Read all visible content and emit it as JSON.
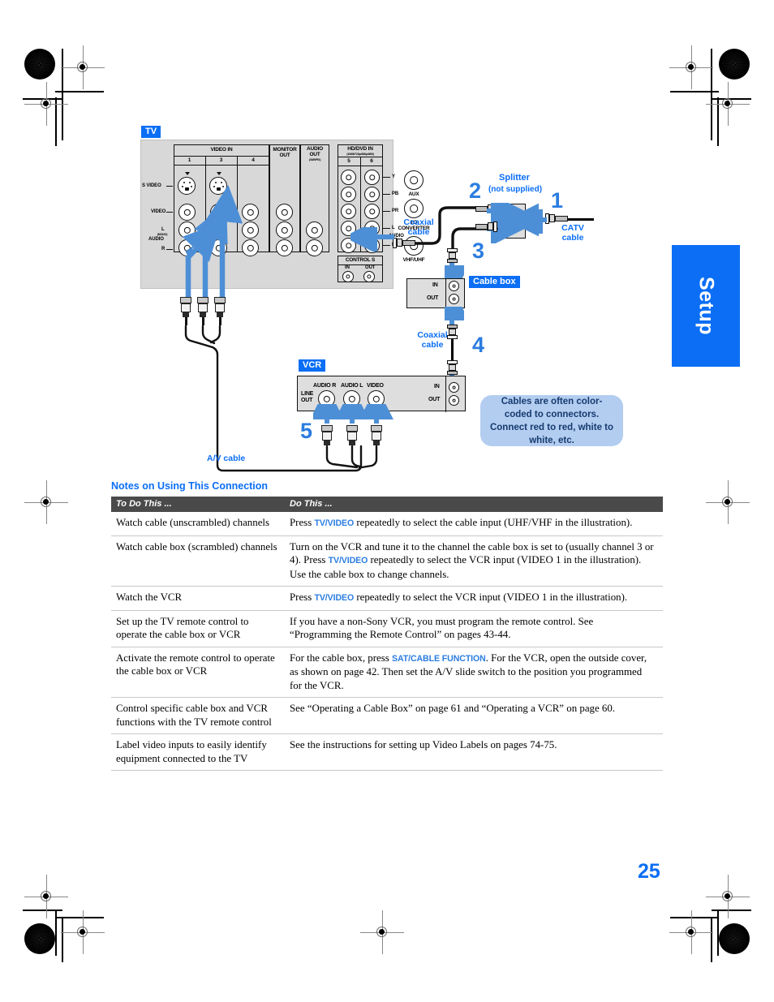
{
  "page": {
    "number": "25",
    "tab_label": "Setup"
  },
  "diagram": {
    "tv_badge": "TV",
    "vcr_badge": "VCR",
    "cable_box_badge": "Cable box",
    "tv_panel": {
      "video_in_title": "VIDEO IN",
      "video_in_columns": [
        "1",
        "3",
        "4"
      ],
      "monitor_out_title": "MONITOR\nOUT",
      "audio_out_title": "AUDIO\nOUT",
      "audio_out_sub": "(VAR/FIX)",
      "row_labels": [
        "S VIDEO",
        "VIDEO",
        "L",
        "AUDIO",
        "R"
      ],
      "l_sub": "(MONO)",
      "hd_dvd_title": "HD/DVD IN",
      "hd_dvd_sub": "(1080i/720p/480p/480i)",
      "hd_dvd_columns": [
        "5",
        "6"
      ],
      "hd_dvd_rows": [
        "Y",
        "PB",
        "PR",
        "L",
        "R"
      ],
      "hd_dvd_audio_label": "AUDIO",
      "aux_label": "AUX",
      "to_converter_label": "TO\nCONVERTER",
      "vhf_uhf_label": "VHF/UHF",
      "control_s_title": "CONTROL S",
      "control_s_in": "IN",
      "control_s_out": "OUT"
    },
    "vcr_panel": {
      "line_out_label": "LINE\nOUT",
      "jack_labels": [
        "AUDIO R",
        "AUDIO L",
        "VIDEO"
      ],
      "in_label": "IN",
      "out_label": "OUT"
    },
    "cable_box": {
      "in_label": "IN",
      "out_label": "OUT"
    },
    "steps": [
      "1",
      "2",
      "3",
      "4",
      "5"
    ],
    "labels": {
      "splitter": "Splitter",
      "splitter_sub": "(not supplied)",
      "catv_cable": "CATV\ncable",
      "coaxial_cable": "Coaxial\ncable",
      "av_cable": "A/V cable"
    },
    "bubble": "Cables are often color-coded to connectors. Connect red to red, white to white, etc."
  },
  "notes": {
    "heading": "Notes on Using This Connection",
    "columns": [
      "To Do This ...",
      "Do This ..."
    ],
    "rows": [
      {
        "todo": "Watch cable (unscrambled) channels",
        "parts": [
          {
            "t": "Press "
          },
          {
            "t": "TV/VIDEO",
            "kw": true
          },
          {
            "t": " repeatedly to select the cable input (UHF/VHF in the illustration)."
          }
        ]
      },
      {
        "todo": "Watch cable box (scrambled) channels",
        "parts": [
          {
            "t": "Turn on the VCR and tune it to the channel the cable box is set to (usually channel 3 or 4). Press "
          },
          {
            "t": "TV/VIDEO",
            "kw": true
          },
          {
            "t": " repeatedly to select the VCR input (VIDEO 1 in the illustration). Use the cable box to change channels."
          }
        ]
      },
      {
        "todo": "Watch the VCR",
        "parts": [
          {
            "t": "Press "
          },
          {
            "t": "TV/VIDEO",
            "kw": true
          },
          {
            "t": " repeatedly to select the VCR input (VIDEO 1 in the illustration)."
          }
        ]
      },
      {
        "todo": "Set up the TV remote control to operate the cable box or VCR",
        "parts": [
          {
            "t": "If you have a non-Sony VCR, you must program the remote control. See “Programming the Remote Control” on pages 43-44."
          }
        ]
      },
      {
        "todo": "Activate the remote control to operate the cable box or VCR",
        "parts": [
          {
            "t": "For the cable box, press "
          },
          {
            "t": "SAT/CABLE FUNCTION",
            "kw": true
          },
          {
            "t": ". For the VCR, open the outside cover, as shown on page 42. Then set the A/V slide switch to the position you programmed for the VCR."
          }
        ]
      },
      {
        "todo": "Control specific cable box and VCR functions with the TV remote control",
        "parts": [
          {
            "t": "See “Operating a Cable Box” on page 61 and “Operating a VCR” on page 60."
          }
        ]
      },
      {
        "todo": "Label video inputs to easily identify equipment connected to the TV",
        "parts": [
          {
            "t": "See the instructions for setting up Video Labels on pages 74-75."
          }
        ]
      }
    ]
  },
  "colors": {
    "accent": "#0b6ef5",
    "step": "#2b7de0",
    "header_bar": "#4a4a4a",
    "bubble": "#b3cdf0"
  }
}
